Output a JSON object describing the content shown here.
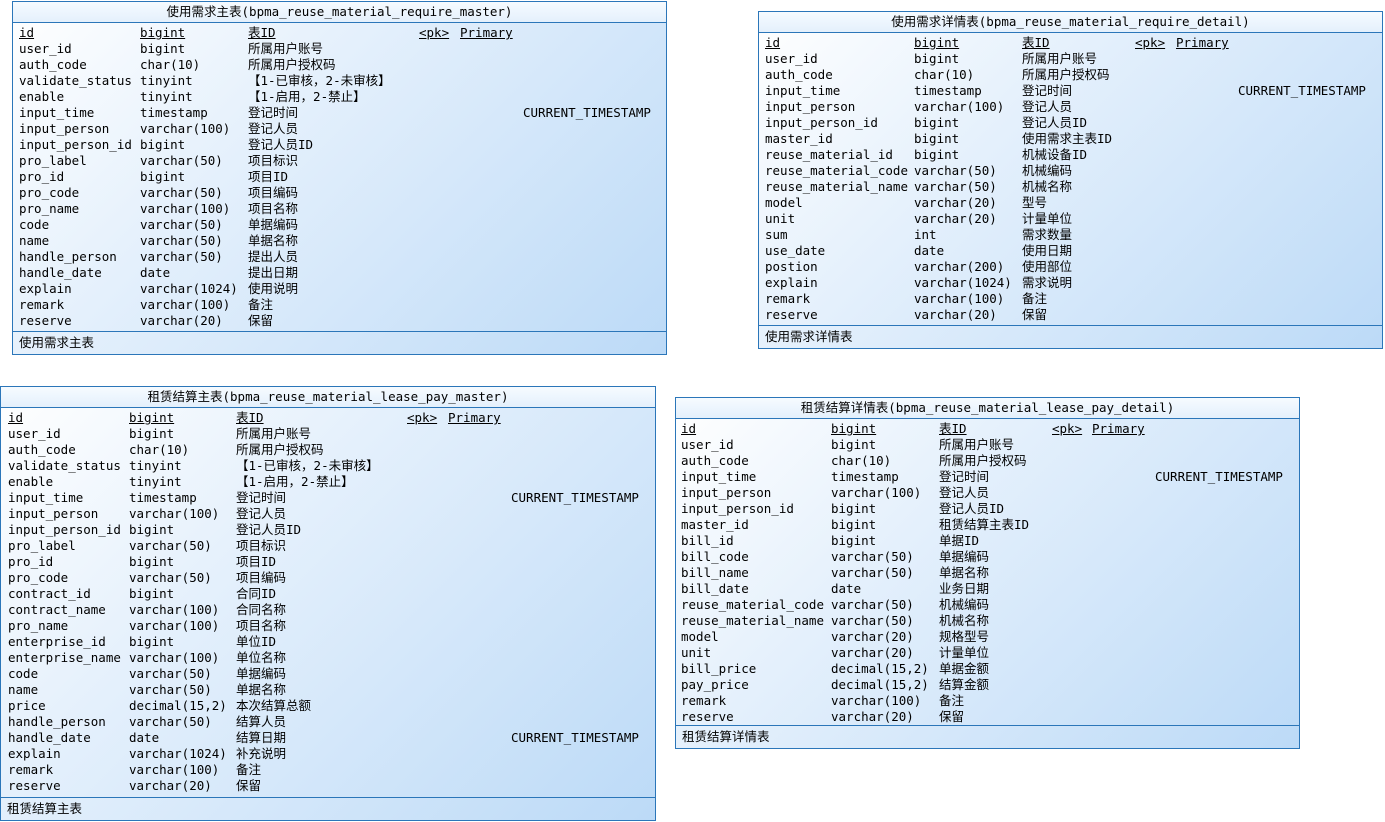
{
  "tables": [
    {
      "title": "使用需求主表(bpma_reuse_material_require_master)",
      "footer": "使用需求主表",
      "header": [
        "id",
        "bigint",
        "表ID",
        "<pk>",
        "Primary"
      ],
      "rows": [
        [
          "user_id",
          "bigint",
          "所属用户账号",
          ""
        ],
        [
          "auth_code",
          "char(10)",
          "所属用户授权码",
          ""
        ],
        [
          "validate_status",
          "tinyint",
          "【1-已审核，2-未审核】",
          ""
        ],
        [
          "enable",
          "tinyint",
          "【1-启用，2-禁止】",
          ""
        ],
        [
          "input_time",
          "timestamp",
          "登记时间",
          "CURRENT_TIMESTAMP"
        ],
        [
          "input_person",
          "varchar(100)",
          "登记人员",
          ""
        ],
        [
          "input_person_id",
          "bigint",
          "登记人员ID",
          ""
        ],
        [
          "pro_label",
          "varchar(50)",
          "项目标识",
          ""
        ],
        [
          "pro_id",
          "bigint",
          "项目ID",
          ""
        ],
        [
          "pro_code",
          "varchar(50)",
          "项目编码",
          ""
        ],
        [
          "pro_name",
          "varchar(100)",
          "项目名称",
          ""
        ],
        [
          "code",
          "varchar(50)",
          "单据编码",
          ""
        ],
        [
          "name",
          "varchar(50)",
          "单据名称",
          ""
        ],
        [
          "handle_person",
          "varchar(50)",
          "提出人员",
          ""
        ],
        [
          "handle_date",
          "date",
          "提出日期",
          ""
        ],
        [
          "explain",
          "varchar(1024)",
          "使用说明",
          ""
        ],
        [
          "remark",
          "varchar(100)",
          "备注",
          ""
        ],
        [
          "reserve",
          "varchar(20)",
          "保留",
          ""
        ]
      ]
    },
    {
      "title": "使用需求详情表(bpma_reuse_material_require_detail)",
      "footer": "使用需求详情表",
      "header": [
        "id",
        "bigint",
        "表ID",
        "<pk>",
        "Primary"
      ],
      "rows": [
        [
          "user_id",
          "bigint",
          "所属用户账号",
          ""
        ],
        [
          "auth_code",
          "char(10)",
          "所属用户授权码",
          ""
        ],
        [
          "input_time",
          "timestamp",
          "登记时间",
          "CURRENT_TIMESTAMP"
        ],
        [
          "input_person",
          "varchar(100)",
          "登记人员",
          ""
        ],
        [
          "input_person_id",
          "bigint",
          "登记人员ID",
          ""
        ],
        [
          "master_id",
          "bigint",
          "使用需求主表ID",
          ""
        ],
        [
          "reuse_material_id",
          "bigint",
          "机械设备ID",
          ""
        ],
        [
          "reuse_material_code",
          "varchar(50)",
          "机械编码",
          ""
        ],
        [
          "reuse_material_name",
          "varchar(50)",
          "机械名称",
          ""
        ],
        [
          "model",
          "varchar(20)",
          "型号",
          ""
        ],
        [
          "unit",
          "varchar(20)",
          "计量单位",
          ""
        ],
        [
          "sum",
          "int",
          "需求数量",
          ""
        ],
        [
          "use_date",
          "date",
          "使用日期",
          ""
        ],
        [
          "postion",
          "varchar(200)",
          "使用部位",
          ""
        ],
        [
          "explain",
          "varchar(1024)",
          "需求说明",
          ""
        ],
        [
          "remark",
          "varchar(100)",
          "备注",
          ""
        ],
        [
          "reserve",
          "varchar(20)",
          "保留",
          ""
        ]
      ]
    },
    {
      "title": "租赁结算主表(bpma_reuse_material_lease_pay_master)",
      "footer": "租赁结算主表",
      "header": [
        "id",
        "bigint",
        "表ID",
        "<pk>",
        "Primary"
      ],
      "rows": [
        [
          "user_id",
          "bigint",
          "所属用户账号",
          ""
        ],
        [
          "auth_code",
          "char(10)",
          "所属用户授权码",
          ""
        ],
        [
          "validate_status",
          "tinyint",
          "【1-已审核，2-未审核】",
          ""
        ],
        [
          "enable",
          "tinyint",
          "【1-启用，2-禁止】",
          ""
        ],
        [
          "input_time",
          "timestamp",
          "登记时间",
          "CURRENT_TIMESTAMP"
        ],
        [
          "input_person",
          "varchar(100)",
          "登记人员",
          ""
        ],
        [
          "input_person_id",
          "bigint",
          "登记人员ID",
          ""
        ],
        [
          "pro_label",
          "varchar(50)",
          "项目标识",
          ""
        ],
        [
          "pro_id",
          "bigint",
          "项目ID",
          ""
        ],
        [
          "pro_code",
          "varchar(50)",
          "项目编码",
          ""
        ],
        [
          "contract_id",
          "bigint",
          "合同ID",
          ""
        ],
        [
          "contract_name",
          "varchar(100)",
          "合同名称",
          ""
        ],
        [
          "pro_name",
          "varchar(100)",
          "项目名称",
          ""
        ],
        [
          "enterprise_id",
          "bigint",
          "单位ID",
          ""
        ],
        [
          "enterprise_name",
          "varchar(100)",
          "单位名称",
          ""
        ],
        [
          "code",
          "varchar(50)",
          "单据编码",
          ""
        ],
        [
          "name",
          "varchar(50)",
          "单据名称",
          ""
        ],
        [
          "price",
          "decimal(15,2)",
          "本次结算总额",
          ""
        ],
        [
          "handle_person",
          "varchar(50)",
          "结算人员",
          ""
        ],
        [
          "handle_date",
          "date",
          "结算日期",
          "CURRENT_TIMESTAMP"
        ],
        [
          "explain",
          "varchar(1024)",
          "补充说明",
          ""
        ],
        [
          "remark",
          "varchar(100)",
          "备注",
          ""
        ],
        [
          "reserve",
          "varchar(20)",
          "保留",
          ""
        ]
      ]
    },
    {
      "title": "租赁结算详情表(bpma_reuse_material_lease_pay_detail)",
      "footer": "租赁结算详情表",
      "header": [
        "id",
        "bigint",
        "表ID",
        "<pk>",
        "Primary"
      ],
      "rows": [
        [
          "user_id",
          "bigint",
          "所属用户账号",
          ""
        ],
        [
          "auth_code",
          "char(10)",
          "所属用户授权码",
          ""
        ],
        [
          "input_time",
          "timestamp",
          "登记时间",
          "CURRENT_TIMESTAMP"
        ],
        [
          "input_person",
          "varchar(100)",
          "登记人员",
          ""
        ],
        [
          "input_person_id",
          "bigint",
          "登记人员ID",
          ""
        ],
        [
          "master_id",
          "bigint",
          "租赁结算主表ID",
          ""
        ],
        [
          "bill_id",
          "bigint",
          "单据ID",
          ""
        ],
        [
          "bill_code",
          "varchar(50)",
          "单据编码",
          ""
        ],
        [
          "bill_name",
          "varchar(50)",
          "单据名称",
          ""
        ],
        [
          "bill_date",
          "date",
          "业务日期",
          ""
        ],
        [
          "reuse_material_code",
          "varchar(50)",
          "机械编码",
          ""
        ],
        [
          "reuse_material_name",
          "varchar(50)",
          "机械名称",
          ""
        ],
        [
          "model",
          "varchar(20)",
          "规格型号",
          ""
        ],
        [
          "unit",
          "varchar(20)",
          "计量单位",
          ""
        ],
        [
          "bill_price",
          "decimal(15,2)",
          "单据金额",
          ""
        ],
        [
          "pay_price",
          "decimal(15,2)",
          "结算金额",
          ""
        ],
        [
          "remark",
          "varchar(100)",
          "备注",
          ""
        ],
        [
          "reserve",
          "varchar(20)",
          "保留",
          ""
        ]
      ]
    }
  ]
}
